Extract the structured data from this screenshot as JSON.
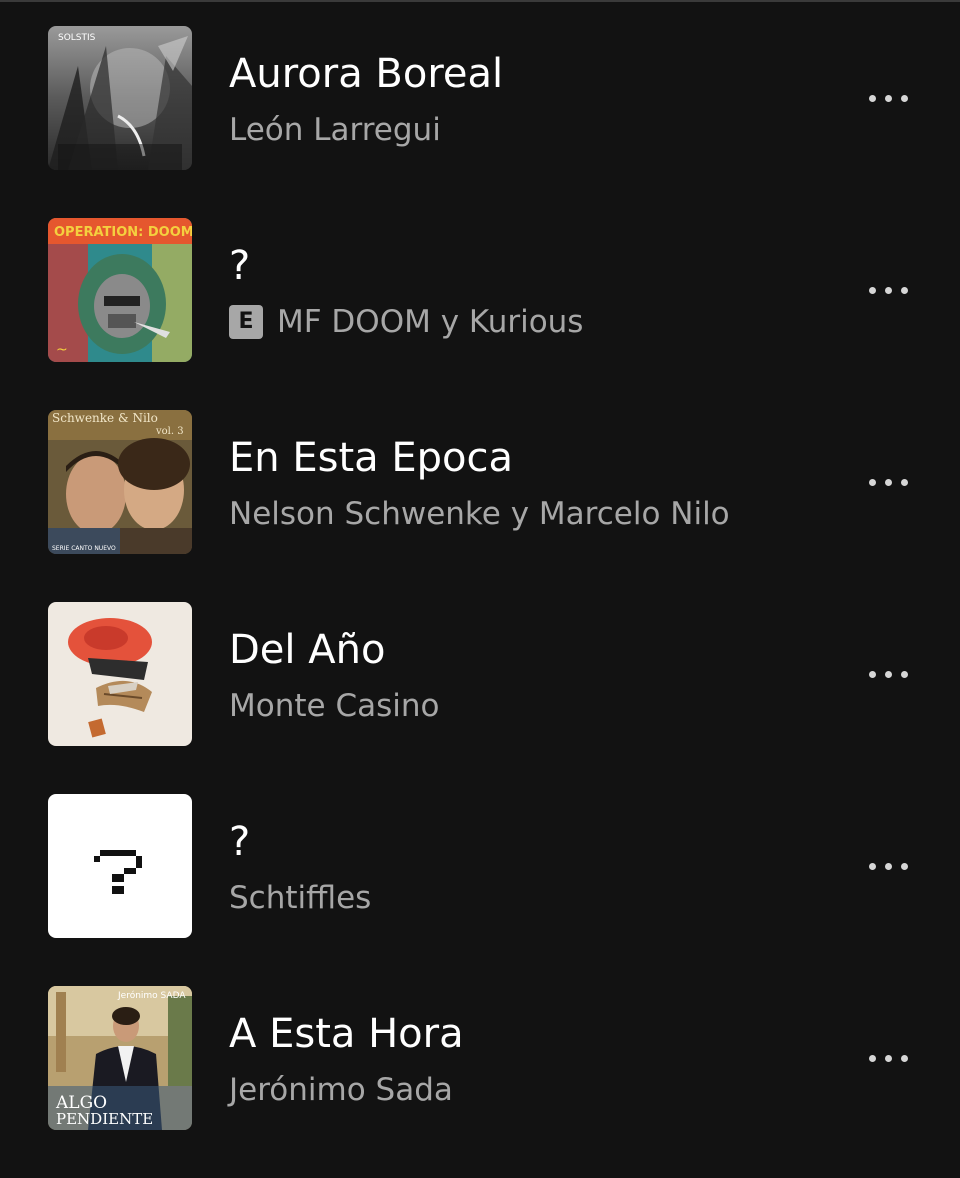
{
  "tracks": [
    {
      "title": "Aurora Boreal",
      "artist": "León Larregui",
      "explicit": false,
      "cover_icon": "album-cover-solstis"
    },
    {
      "title": "?",
      "artist": "MF DOOM y Kurious",
      "explicit": true,
      "explicit_label": "E",
      "cover_icon": "album-cover-operation-doomsday"
    },
    {
      "title": "En Esta Epoca",
      "artist": "Nelson Schwenke y Marcelo Nilo",
      "explicit": false,
      "cover_icon": "album-cover-schwenke-nilo"
    },
    {
      "title": "Del Año",
      "artist": "Monte Casino",
      "explicit": false,
      "cover_icon": "album-cover-collage"
    },
    {
      "title": "?",
      "artist": "Schtiffles",
      "explicit": false,
      "cover_icon": "album-cover-question-mark"
    },
    {
      "title": "A Esta Hora",
      "artist": "Jerónimo Sada",
      "explicit": false,
      "cover_icon": "album-cover-algo-pendiente"
    }
  ],
  "covers": {
    "solstis_text": "SOLSTIS",
    "doomsday_text": "OPERATION: DOOMSDAY",
    "schwenke_text": "Schwenke & Nilo",
    "schwenke_vol": "vol. 3",
    "schwenke_series": "SERIE CANTO NUEVO",
    "sada_artist": "Jerónimo SADA",
    "sada_album_1": "ALGO",
    "sada_album_2": "PENDIENTE"
  },
  "more_icon": "more-horizontal-icon",
  "colors": {
    "background": "#121212",
    "title": "#ffffff",
    "subtitle": "#a7a7a7",
    "more_dots": "#d6d6d6"
  }
}
